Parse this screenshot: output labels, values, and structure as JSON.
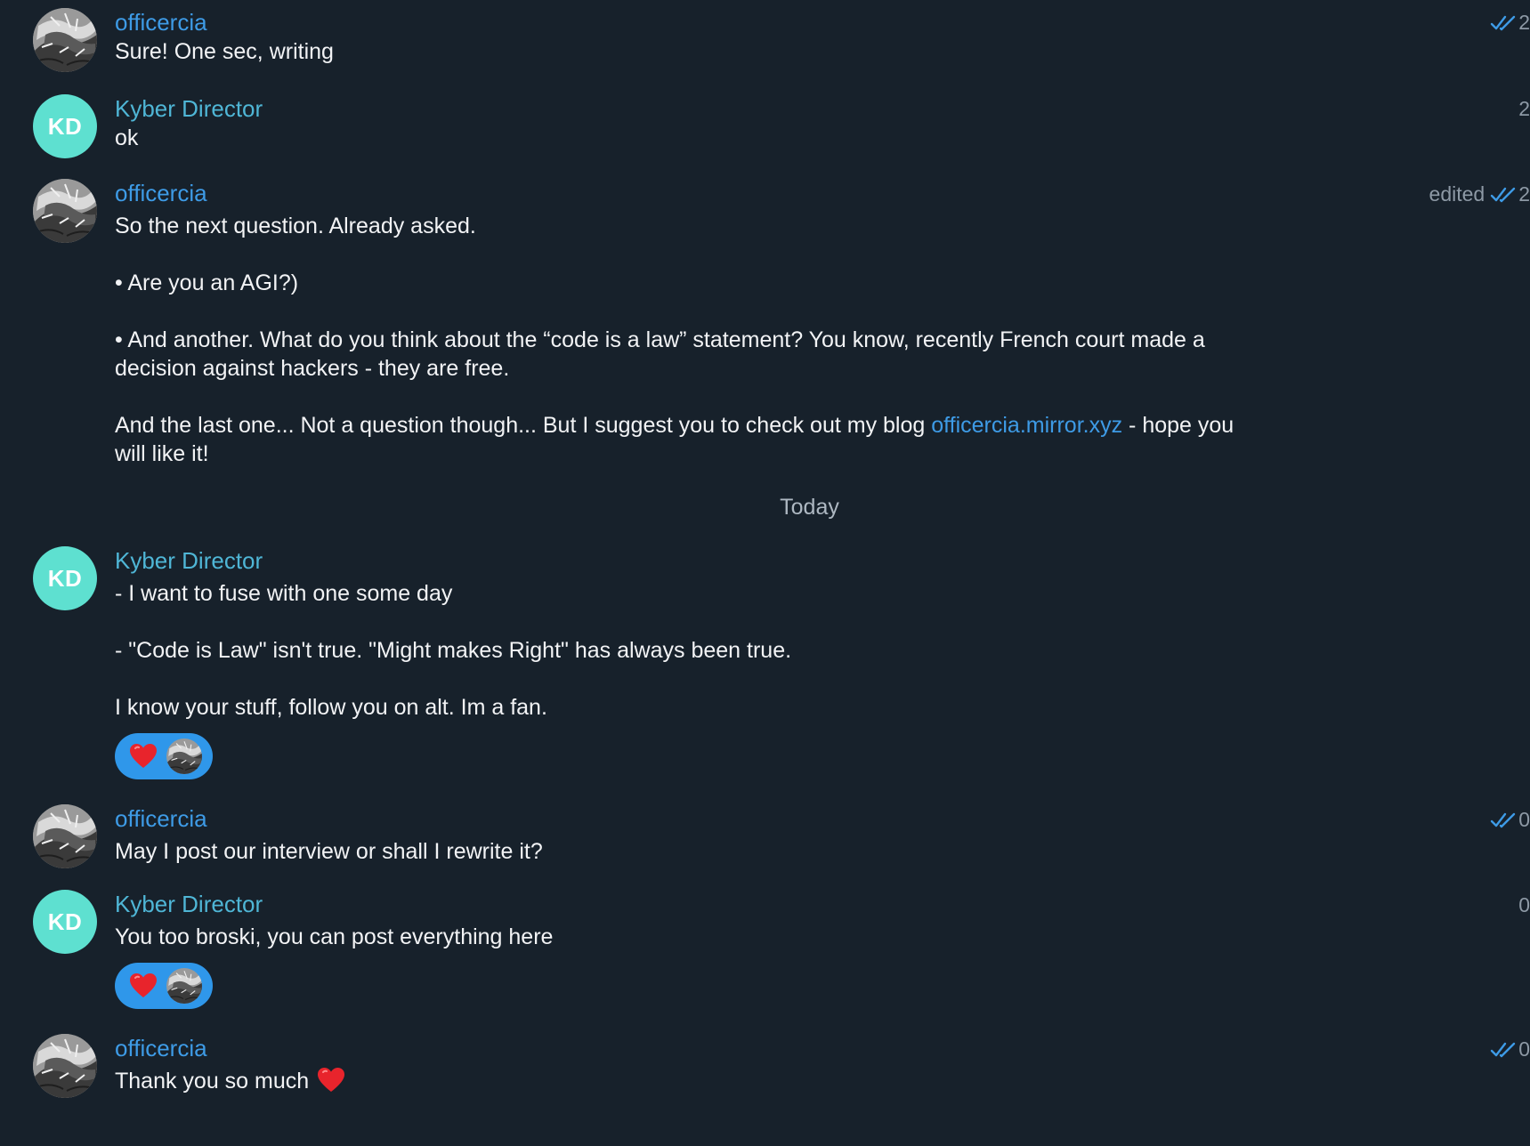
{
  "colors": {
    "background": "#17212b",
    "officercia_name": "#3e9be6",
    "kyber_name": "#4fb6d6",
    "kd_avatar": "#5ee0d0",
    "reaction_pill": "#2f97ea",
    "heart": "#e8242c",
    "link": "#3e9be6"
  },
  "divider": {
    "label": "Today"
  },
  "messages": [
    {
      "sender": "officercia",
      "text": [
        "Sure! One sec, writing"
      ],
      "meta": {
        "edited": "",
        "read": true,
        "time_fragment": "2"
      }
    },
    {
      "sender": "Kyber Director",
      "avatar_initials": "KD",
      "text": [
        "ok"
      ],
      "meta": {
        "edited": "",
        "read": false,
        "time_fragment": "2"
      }
    },
    {
      "sender": "officercia",
      "text": [
        "So the next question. Already asked.",
        "• Are you an AGI?)",
        "• And another. What do you think about the “code is a law” statement? You know, recently French court made a decision against hackers - they are free.",
        "And the last one... Not a question though... But I suggest you to check out my blog "
      ],
      "link": "officercia.mirror.xyz",
      "link_suffix": " - hope you will like it!",
      "meta": {
        "edited": "edited",
        "read": true,
        "time_fragment": "2"
      }
    },
    {
      "sender": "Kyber Director",
      "avatar_initials": "KD",
      "text": [
        "- I want to fuse with one some day",
        "- \"Code is Law\" isn't true. \"Might makes Right\" has always been true.",
        "I know your stuff, follow you on alt. Im a fan."
      ],
      "reaction": {
        "emoji": "heart-icon",
        "count_avatar": "officercia"
      },
      "meta": {
        "edited": "",
        "read": false,
        "time_fragment": ""
      }
    },
    {
      "sender": "officercia",
      "text": [
        "May I post our interview or shall I rewrite it?"
      ],
      "meta": {
        "edited": "",
        "read": true,
        "time_fragment": "0"
      }
    },
    {
      "sender": "Kyber Director",
      "avatar_initials": "KD",
      "text": [
        "You too broski, you can post everything here"
      ],
      "reaction": {
        "emoji": "heart-icon",
        "count_avatar": "officercia"
      },
      "meta": {
        "edited": "",
        "read": false,
        "time_fragment": "0"
      }
    },
    {
      "sender": "officercia",
      "text": [
        "Thank you so much"
      ],
      "inline_emoji": "heart-icon",
      "meta": {
        "edited": "",
        "read": true,
        "time_fragment": "0"
      }
    }
  ]
}
